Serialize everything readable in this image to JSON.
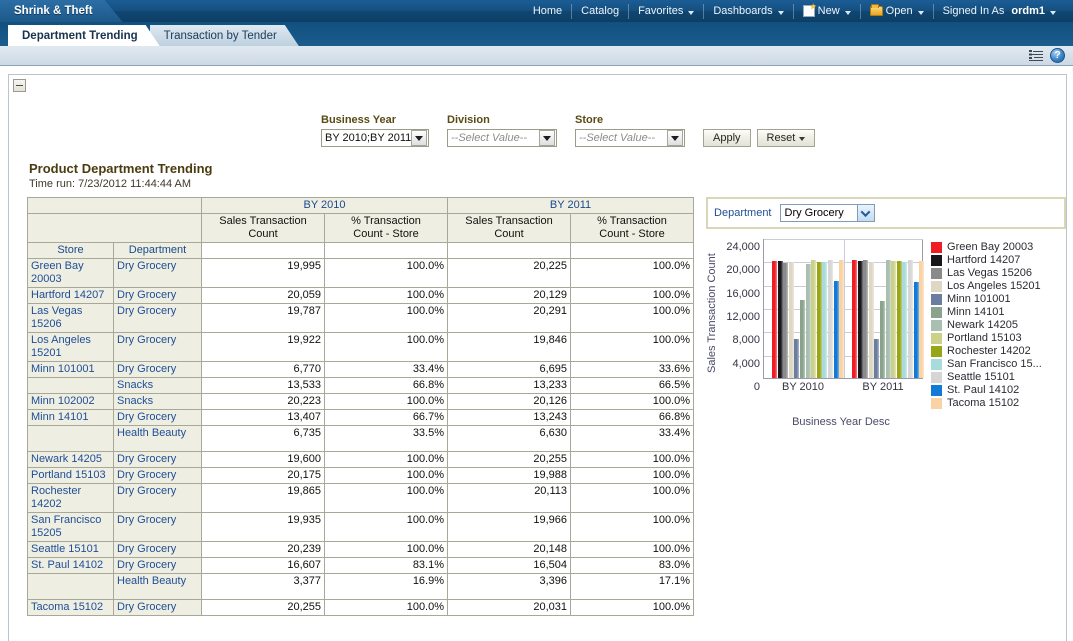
{
  "topbar": {
    "brand": "Shrink & Theft",
    "nav": [
      {
        "label": "Home",
        "icon": null,
        "caret": false
      },
      {
        "label": "Catalog",
        "icon": null,
        "caret": false
      },
      {
        "label": "Favorites",
        "icon": null,
        "caret": true
      },
      {
        "label": "Dashboards",
        "icon": null,
        "caret": true
      },
      {
        "label": "New",
        "icon": "new-page-icon",
        "caret": true
      },
      {
        "label": "Open",
        "icon": "folder-icon",
        "caret": true
      }
    ],
    "signed_in_label": "Signed In As",
    "user": "ordm1"
  },
  "tabs": [
    {
      "label": "Department Trending",
      "active": true
    },
    {
      "label": "Transaction by Tender",
      "active": false
    }
  ],
  "subbar": {
    "list_icon": "page-options-icon",
    "help_icon": "help-icon",
    "help_glyph": "?"
  },
  "collapse_icon": "collapse-minus-icon",
  "prompts": {
    "business_year": {
      "label": "Business Year",
      "value": "BY 2010;BY 2011",
      "placeholder": "--Select Value--"
    },
    "division": {
      "label": "Division",
      "value": "--Select Value--",
      "placeholder": "--Select Value--"
    },
    "store": {
      "label": "Store",
      "value": "--Select Value--",
      "placeholder": "--Select Value--"
    },
    "apply_label": "Apply",
    "reset_label": "Reset"
  },
  "report": {
    "title": "Product Department Trending",
    "time_run": "Time run: 7/23/2012 11:44:44 AM"
  },
  "table": {
    "year_headers": [
      "BY 2010",
      "BY 2011"
    ],
    "measure_headers": [
      "Sales Transaction Count",
      "% Transaction Count - Store",
      "Sales Transaction Count",
      "% Transaction Count - Store"
    ],
    "measure_headers_split": [
      [
        "Sales Transaction",
        "Count"
      ],
      [
        "% Transaction",
        "Count - Store"
      ],
      [
        "Sales Transaction",
        "Count"
      ],
      [
        "% Transaction",
        "Count - Store"
      ]
    ],
    "dim_headers": [
      "Store",
      "Department"
    ],
    "rows": [
      {
        "store": "Green Bay 20003",
        "dept": "Dry Grocery",
        "v2010": "19,995",
        "p2010": "100.0%",
        "v2011": "20,225",
        "p2011": "100.0%",
        "tall": true
      },
      {
        "store": "Hartford 14207",
        "dept": "Dry Grocery",
        "v2010": "20,059",
        "p2010": "100.0%",
        "v2011": "20,129",
        "p2011": "100.0%",
        "tall": false
      },
      {
        "store": "Las Vegas 15206",
        "dept": "Dry Grocery",
        "v2010": "19,787",
        "p2010": "100.0%",
        "v2011": "20,291",
        "p2011": "100.0%",
        "tall": true
      },
      {
        "store": "Los Angeles 15201",
        "dept": "Dry Grocery",
        "v2010": "19,922",
        "p2010": "100.0%",
        "v2011": "19,846",
        "p2011": "100.0%",
        "tall": true
      },
      {
        "store": "Minn 101001",
        "dept": "Dry Grocery",
        "v2010": "6,770",
        "p2010": "33.4%",
        "v2011": "6,695",
        "p2011": "33.6%",
        "tall": false
      },
      {
        "store": "",
        "dept": "Snacks",
        "v2010": "13,533",
        "p2010": "66.8%",
        "v2011": "13,233",
        "p2011": "66.5%",
        "tall": false
      },
      {
        "store": "Minn 102002",
        "dept": "Snacks",
        "v2010": "20,223",
        "p2010": "100.0%",
        "v2011": "20,126",
        "p2011": "100.0%",
        "tall": false
      },
      {
        "store": "Minn 14101",
        "dept": "Dry Grocery",
        "v2010": "13,407",
        "p2010": "66.7%",
        "v2011": "13,243",
        "p2011": "66.8%",
        "tall": false
      },
      {
        "store": "",
        "dept": "Health Beauty",
        "v2010": "6,735",
        "p2010": "33.5%",
        "v2011": "6,630",
        "p2011": "33.4%",
        "tall": true
      },
      {
        "store": "Newark 14205",
        "dept": "Dry Grocery",
        "v2010": "19,600",
        "p2010": "100.0%",
        "v2011": "20,255",
        "p2011": "100.0%",
        "tall": false
      },
      {
        "store": "Portland 15103",
        "dept": "Dry Grocery",
        "v2010": "20,175",
        "p2010": "100.0%",
        "v2011": "19,988",
        "p2011": "100.0%",
        "tall": false
      },
      {
        "store": "Rochester 14202",
        "dept": "Dry Grocery",
        "v2010": "19,865",
        "p2010": "100.0%",
        "v2011": "20,113",
        "p2011": "100.0%",
        "tall": true
      },
      {
        "store": "San Francisco 15205",
        "dept": "Dry Grocery",
        "v2010": "19,935",
        "p2010": "100.0%",
        "v2011": "19,966",
        "p2011": "100.0%",
        "tall": true
      },
      {
        "store": "Seattle 15101",
        "dept": "Dry Grocery",
        "v2010": "20,239",
        "p2010": "100.0%",
        "v2011": "20,148",
        "p2011": "100.0%",
        "tall": false
      },
      {
        "store": "St. Paul 14102",
        "dept": "Dry Grocery",
        "v2010": "16,607",
        "p2010": "83.1%",
        "v2011": "16,504",
        "p2011": "83.0%",
        "tall": false
      },
      {
        "store": "",
        "dept": "Health Beauty",
        "v2010": "3,377",
        "p2010": "16.9%",
        "v2011": "3,396",
        "p2011": "17.1%",
        "tall": true
      },
      {
        "store": "Tacoma 15102",
        "dept": "Dry Grocery",
        "v2010": "20,255",
        "p2010": "100.0%",
        "v2011": "20,031",
        "p2011": "100.0%",
        "tall": false
      }
    ]
  },
  "chart_panel": {
    "dept_label": "Department",
    "dept_value": "Dry Grocery",
    "dropdown_icon": "chevron-down-icon"
  },
  "chart_data": {
    "type": "bar",
    "title": "",
    "xlabel": "Business Year Desc",
    "ylabel": "Sales Transaction Count",
    "categories": [
      "BY 2010",
      "BY 2011"
    ],
    "ylim": [
      0,
      24000
    ],
    "yticks": [
      0,
      4000,
      8000,
      12000,
      16000,
      20000,
      24000
    ],
    "ytick_labels": [
      "0",
      "4,000",
      "8,000",
      "12,000",
      "16,000",
      "20,000",
      "24,000"
    ],
    "grid": true,
    "legend_position": "right",
    "series": [
      {
        "name": "Green Bay 20003",
        "color": "#ef1c24",
        "values": [
          19995,
          20225
        ]
      },
      {
        "name": "Hartford 14207",
        "color": "#17161a",
        "values": [
          20059,
          20129
        ]
      },
      {
        "name": "Las Vegas 15206",
        "color": "#8a8a8a",
        "values": [
          19787,
          20291
        ]
      },
      {
        "name": "Los Angeles 15201",
        "color": "#ded7c3",
        "values": [
          19922,
          19846
        ]
      },
      {
        "name": "Minn 101001",
        "color": "#6b7ea0",
        "values": [
          6770,
          6695
        ]
      },
      {
        "name": "Minn 14101",
        "color": "#8aa38c",
        "values": [
          13407,
          13243
        ]
      },
      {
        "name": "Newark 14205",
        "color": "#a9bfb2",
        "values": [
          19600,
          20255
        ]
      },
      {
        "name": "Portland 15103",
        "color": "#ccd18a",
        "values": [
          20175,
          19988
        ]
      },
      {
        "name": "Rochester 14202",
        "color": "#97a617",
        "values": [
          19865,
          20113
        ]
      },
      {
        "name": "San Francisco 15...",
        "color": "#a8dcdc",
        "values": [
          19935,
          19966
        ]
      },
      {
        "name": "Seattle 15101",
        "color": "#d6d6d6",
        "values": [
          20239,
          20148
        ]
      },
      {
        "name": "St. Paul 14102",
        "color": "#1179d6",
        "values": [
          16607,
          16504
        ]
      },
      {
        "name": "Tacoma 15102",
        "color": "#fad3a4",
        "values": [
          20255,
          20031
        ]
      }
    ]
  }
}
